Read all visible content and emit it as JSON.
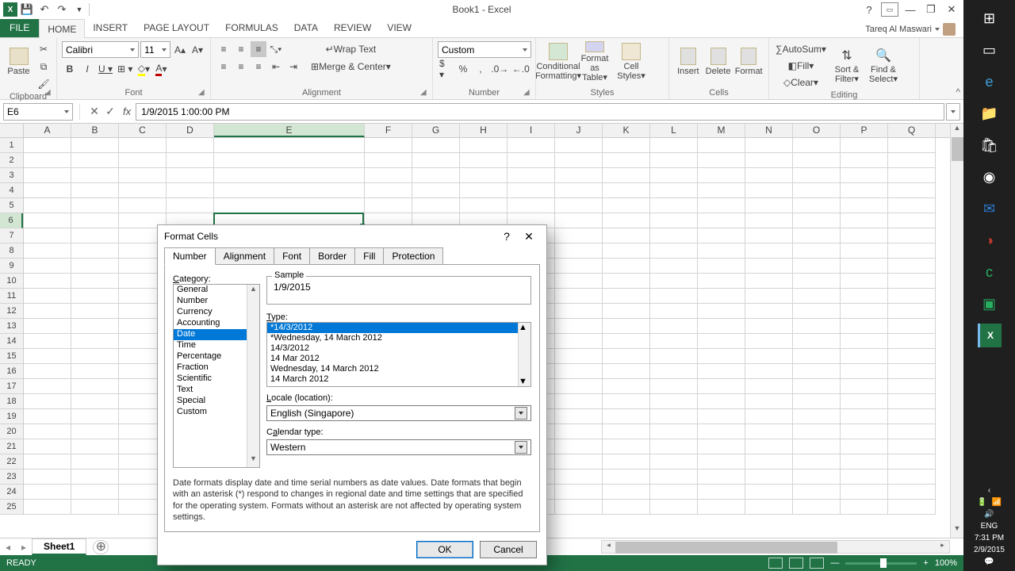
{
  "app": {
    "title": "Book1 - Excel"
  },
  "user": {
    "name": "Tareq Al Maswari"
  },
  "tabs": {
    "file": "FILE",
    "items": [
      "HOME",
      "INSERT",
      "PAGE LAYOUT",
      "FORMULAS",
      "DATA",
      "REVIEW",
      "VIEW"
    ],
    "active": 0
  },
  "ribbon": {
    "clipboard": {
      "paste": "Paste",
      "label": "Clipboard"
    },
    "font": {
      "name": "Calibri",
      "size": "11",
      "label": "Font"
    },
    "alignment": {
      "wrap": "Wrap Text",
      "merge": "Merge & Center",
      "label": "Alignment"
    },
    "number": {
      "format": "Custom",
      "label": "Number"
    },
    "styles": {
      "cond": "Conditional Formatting",
      "table": "Format as Table",
      "cell": "Cell Styles",
      "label": "Styles"
    },
    "cells": {
      "insert": "Insert",
      "delete": "Delete",
      "format": "Format",
      "label": "Cells"
    },
    "editing": {
      "autosum": "AutoSum",
      "fill": "Fill",
      "clear": "Clear",
      "sort": "Sort & Filter",
      "find": "Find & Select",
      "label": "Editing"
    }
  },
  "formula_bar": {
    "cell_ref": "E6",
    "value": "1/9/2015  1:00:00 PM"
  },
  "columns": [
    "A",
    "B",
    "C",
    "D",
    "E",
    "F",
    "G",
    "H",
    "I",
    "J",
    "K",
    "L",
    "M",
    "N",
    "O",
    "P",
    "Q"
  ],
  "selected_col": "E",
  "selected_row": 6,
  "sheet": {
    "active": "Sheet1"
  },
  "status": {
    "state": "READY",
    "zoom": "100%"
  },
  "dialog": {
    "title": "Format Cells",
    "tabs": [
      "Number",
      "Alignment",
      "Font",
      "Border",
      "Fill",
      "Protection"
    ],
    "active_tab": 0,
    "category_label": "Category:",
    "categories": [
      "General",
      "Number",
      "Currency",
      "Accounting",
      "Date",
      "Time",
      "Percentage",
      "Fraction",
      "Scientific",
      "Text",
      "Special",
      "Custom"
    ],
    "selected_category": "Date",
    "sample_label": "Sample",
    "sample_value": "1/9/2015",
    "type_label": "Type:",
    "types": [
      "*14/3/2012",
      "*Wednesday, 14 March 2012",
      "14/3/2012",
      "14 Mar 2012",
      "Wednesday, 14 March 2012",
      "14 March 2012"
    ],
    "selected_type": "*14/3/2012",
    "locale_label": "Locale (location):",
    "locale_value": "English (Singapore)",
    "calendar_label": "Calendar type:",
    "calendar_value": "Western",
    "description": "Date formats display date and time serial numbers as date values.  Date formats that begin with an asterisk (*) respond to changes in regional date and time settings that are specified for the operating system. Formats without an asterisk are not affected by operating system settings.",
    "ok": "OK",
    "cancel": "Cancel"
  },
  "windows_tray": {
    "lang": "ENG",
    "time": "7:31 PM",
    "date": "2/9/2015"
  }
}
